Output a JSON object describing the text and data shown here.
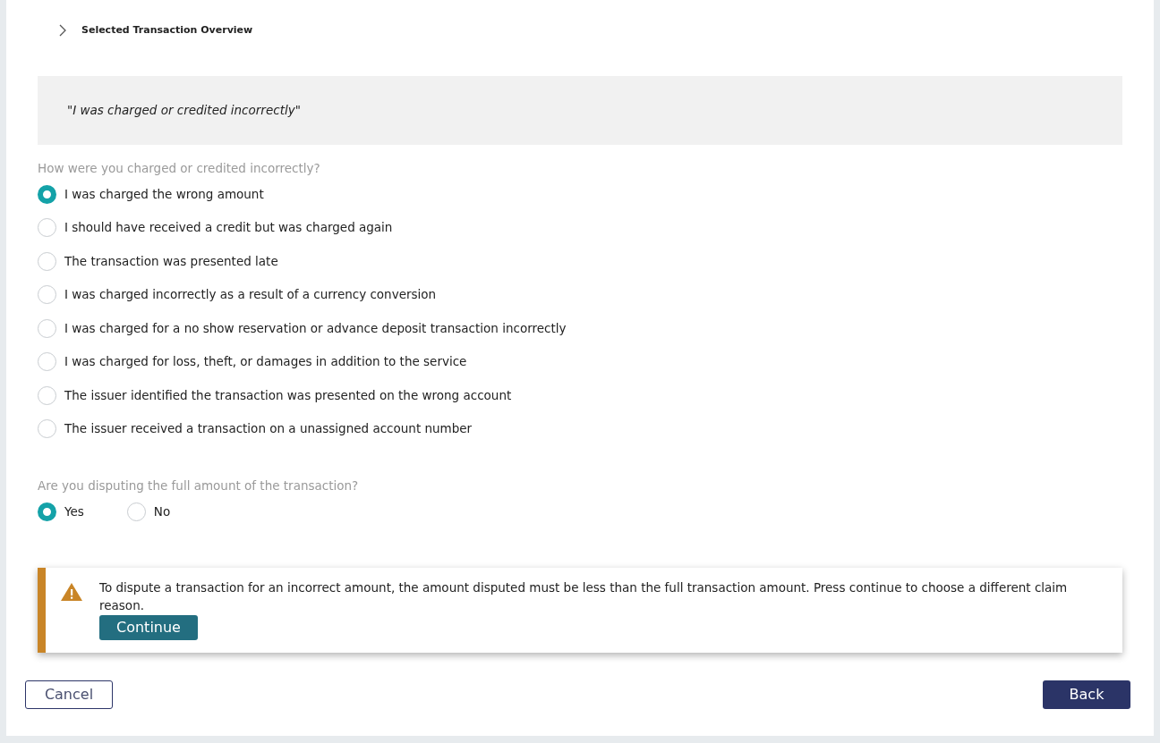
{
  "overview": {
    "title": "Selected Transaction Overview",
    "expanded": false
  },
  "reason_quote": "\"I was charged or credited incorrectly\"",
  "question_1": {
    "label": "How were you charged or credited incorrectly?",
    "options": [
      {
        "label": "I was charged the wrong amount",
        "selected": true
      },
      {
        "label": "I should have received a credit but was charged again",
        "selected": false
      },
      {
        "label": "The transaction was presented late",
        "selected": false
      },
      {
        "label": "I was charged incorrectly as a result of a currency conversion",
        "selected": false
      },
      {
        "label": "I was charged for a no show reservation or advance deposit transaction incorrectly",
        "selected": false
      },
      {
        "label": "I was charged for loss, theft, or damages in addition to the service",
        "selected": false
      },
      {
        "label": "The issuer identified the transaction was presented on the wrong account",
        "selected": false
      },
      {
        "label": "The issuer received a transaction on a unassigned account number",
        "selected": false
      }
    ]
  },
  "question_2": {
    "label": "Are you disputing the full amount of the transaction?",
    "options": [
      {
        "label": "Yes",
        "selected": true
      },
      {
        "label": "No",
        "selected": false
      }
    ]
  },
  "warning": {
    "message": "To dispute a transaction for an incorrect amount, the amount disputed must be less than the full transaction amount. Press continue to choose a different claim reason.",
    "button": "Continue"
  },
  "footer": {
    "cancel": "Cancel",
    "back": "Back"
  }
}
